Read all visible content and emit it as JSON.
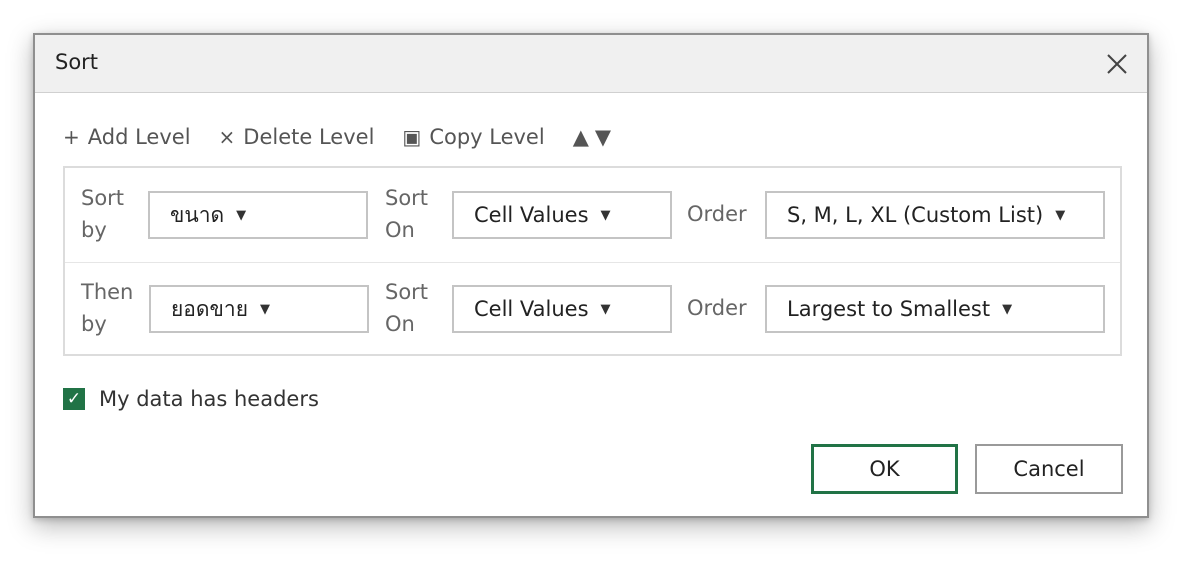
{
  "dialog": {
    "title": "Sort"
  },
  "toolbar": {
    "add_glyph": "+",
    "add_label": "Add Level",
    "delete_glyph": "×",
    "delete_label": "Delete Level",
    "copy_glyph": "▣",
    "copy_label": "Copy Level",
    "up_glyph": "▲",
    "down_glyph": "▼"
  },
  "levels": [
    {
      "sort_label_line1": "Sort",
      "sort_label_line2": "by",
      "column": "ขนาด",
      "sort_on_line1": "Sort",
      "sort_on_line2": "On",
      "sort_on": "Cell Values",
      "order_label": "Order",
      "order": "S, M, L, XL (Custom List)"
    },
    {
      "sort_label_line1": "Then",
      "sort_label_line2": "by",
      "column": "ยอดขาย",
      "sort_on_line1": "Sort",
      "sort_on_line2": "On",
      "sort_on": "Cell Values",
      "order_label": "Order",
      "order": "Largest to Smallest"
    }
  ],
  "options": {
    "has_headers_label": "My data has headers",
    "has_headers_checked": true,
    "check_glyph": "✓"
  },
  "buttons": {
    "ok_label": "OK",
    "cancel_label": "Cancel"
  },
  "caret_glyph": "▼",
  "colors": {
    "accent": "#217346",
    "titlebar": "#f0f0f0"
  }
}
